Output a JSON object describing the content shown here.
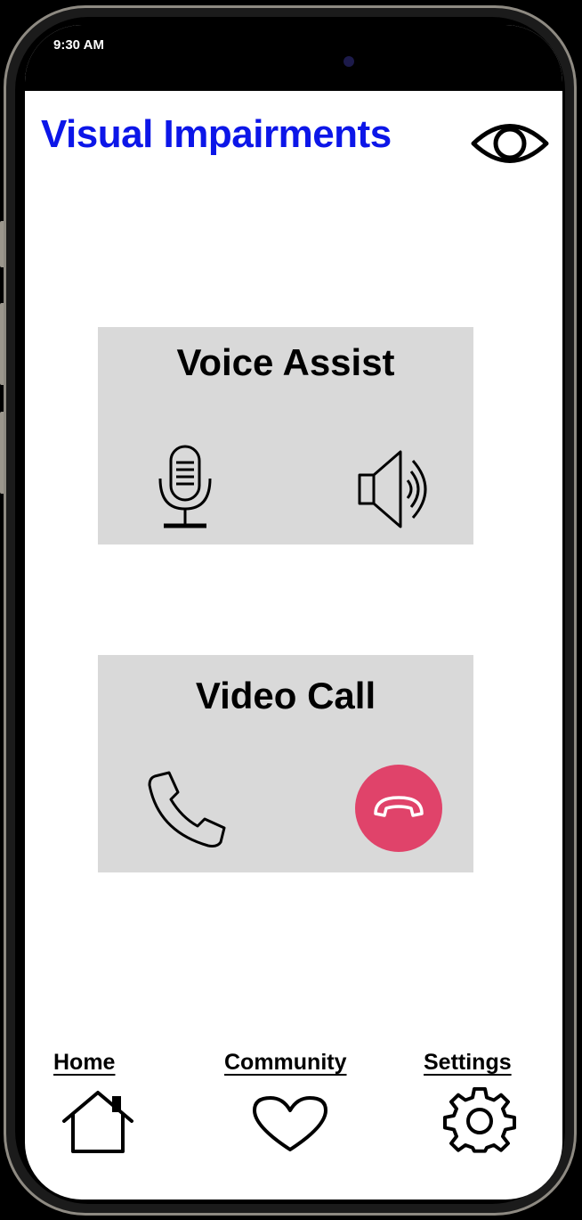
{
  "status_bar": {
    "time": "9:30 AM"
  },
  "header": {
    "title": "Visual Impairments",
    "icon": "eye-icon"
  },
  "cards": {
    "voice_assist": {
      "title": "Voice Assist",
      "icons": [
        "microphone-icon",
        "speaker-icon"
      ]
    },
    "video_call": {
      "title": "Video Call",
      "icons": [
        "phone-icon",
        "hang-up-icon"
      ]
    }
  },
  "nav": {
    "home": {
      "label": "Home",
      "icon": "home-icon"
    },
    "community": {
      "label": "Community",
      "icon": "heart-icon"
    },
    "settings": {
      "label": "Settings",
      "icon": "gear-icon"
    }
  },
  "colors": {
    "title": "#0c16e8",
    "card_bg": "#d9d9d9",
    "hang_up": "#e0436a"
  }
}
